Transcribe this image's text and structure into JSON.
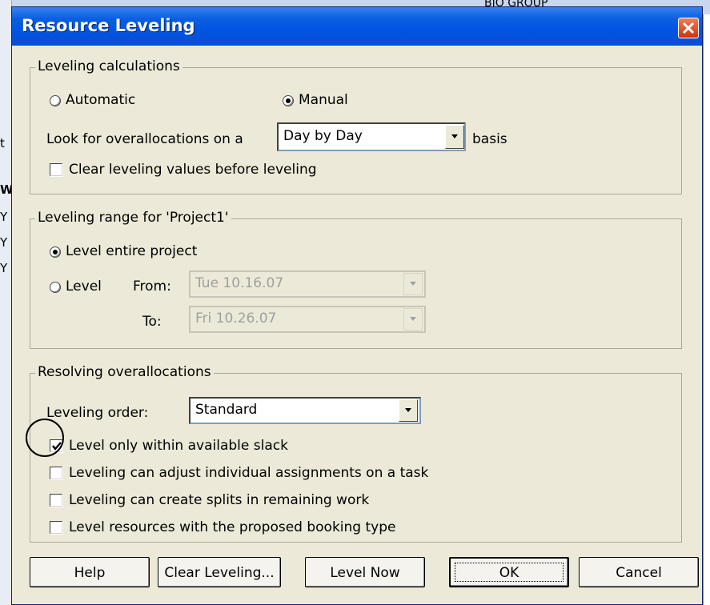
{
  "background": {
    "top_text": "BIO GROUP",
    "left_marks": [
      "t",
      "W",
      "Y",
      "Y",
      "Y"
    ]
  },
  "dialog": {
    "title": "Resource Leveling"
  },
  "leveling_calculations": {
    "legend": "Leveling calculations",
    "automatic": {
      "label": "Automatic",
      "selected": false
    },
    "manual": {
      "label": "Manual",
      "selected": true
    },
    "look_for_label": "Look for overallocations on a",
    "basis_value": "Day by Day",
    "basis_suffix": "basis",
    "clear_values": {
      "label": "Clear leveling values before leveling",
      "checked": false
    }
  },
  "leveling_range": {
    "legend": "Leveling range for 'Project1'",
    "entire": {
      "label": "Level entire project",
      "selected": true
    },
    "level": {
      "label": "Level",
      "selected": false
    },
    "from_label": "From:",
    "from_value": "Tue 10.16.07",
    "to_label": "To:",
    "to_value": "Fri 10.26.07"
  },
  "resolving": {
    "legend": "Resolving overallocations",
    "order_label": "Leveling order:",
    "order_value": "Standard",
    "options": [
      {
        "label": "Level only within available slack",
        "checked": true
      },
      {
        "label": "Leveling can adjust individual assignments on a task",
        "checked": false
      },
      {
        "label": "Leveling can create splits in remaining work",
        "checked": false
      },
      {
        "label": "Level resources with the proposed booking type",
        "checked": false
      }
    ]
  },
  "buttons": {
    "help": "Help",
    "clear_leveling": "Clear Leveling...",
    "level_now": "Level Now",
    "ok": "OK",
    "cancel": "Cancel"
  },
  "colors": {
    "title_bar": "#0054e3",
    "dialog_bg": "#ece9d8",
    "close_button": "#d84a20"
  }
}
